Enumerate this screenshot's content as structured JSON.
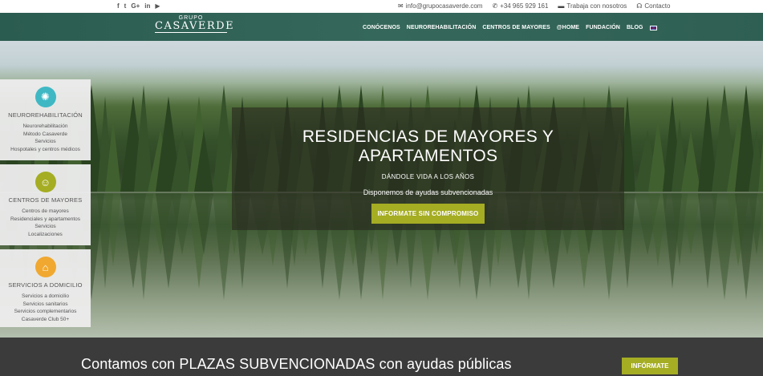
{
  "topbar": {
    "social": [
      {
        "icon": "facebook-icon",
        "glyph": "f"
      },
      {
        "icon": "twitter-icon",
        "glyph": "t"
      },
      {
        "icon": "google-plus-icon",
        "glyph": "G+"
      },
      {
        "icon": "linkedin-icon",
        "glyph": "in"
      },
      {
        "icon": "youtube-icon",
        "glyph": "▶"
      }
    ],
    "email": "info@grupocasaverde.com",
    "phone": "+34 965 929 161",
    "jobs": "Trabaja con nosotros",
    "contact": "Contacto"
  },
  "nav": {
    "logo_small": "GRUPO",
    "logo_big": "CASAVERDE",
    "items": [
      "CONÓCENOS",
      "NEUROREHABILITACIÓN",
      "CENTROS DE MAYORES",
      "@HOME",
      "FUNDACIÓN",
      "BLOG"
    ],
    "language_icon": "uk-flag-icon"
  },
  "hero": {
    "title": "RESIDENCIAS DE MAYORES Y APARTAMENTOS",
    "subtitle": "DÁNDOLE VIDA A LOS AÑOS",
    "text": "Disponemos de ayudas subvencionadas",
    "button": "INFORMATE SIN COMPROMISO"
  },
  "cards": [
    {
      "title": "NEUROREHABILITACIÓN",
      "icon": "brain-icon",
      "color": "#3fb8c4",
      "items": [
        "Neurorehabilitación",
        "Método Casaverde",
        "Servicios",
        "Hospotales y centros médicos"
      ]
    },
    {
      "title": "CENTROS DE MAYORES",
      "icon": "elderly-couple-icon",
      "color": "#a5ad23",
      "items": [
        "Centros de mayores",
        "Residenciales y apartamentos",
        "Servicios",
        "Localizaciones"
      ]
    },
    {
      "title": "SERVICIOS A DOMICILIO",
      "icon": "house-icon",
      "color": "#f0a830",
      "items": [
        "Servicios a domicilio",
        "Servicios sanitarios",
        "Servicios complementarios",
        "Casaverde Club 50+"
      ]
    }
  ],
  "band": {
    "text": "Contamos con PLAZAS SUBVENCIONADAS con ayudas públicas",
    "button": "INFÓRMATE"
  },
  "colors": {
    "nav_green": "#2f5f53",
    "accent_olive": "#a5ad23",
    "band_dark": "#3b3b3b"
  }
}
